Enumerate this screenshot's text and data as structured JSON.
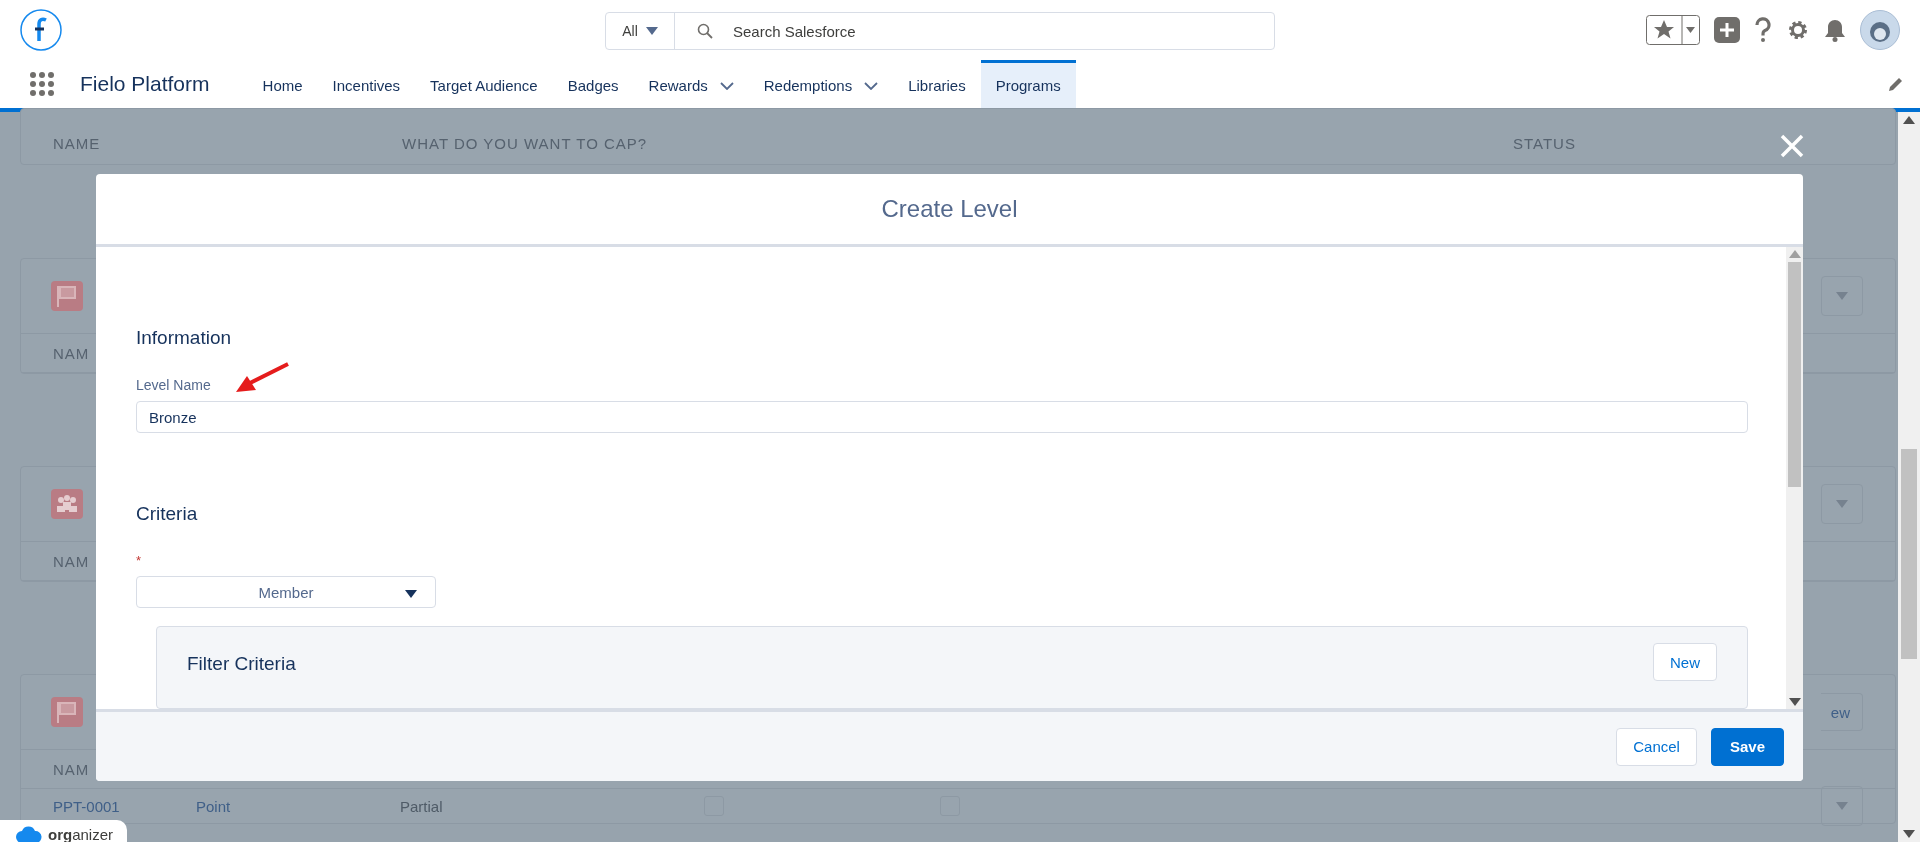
{
  "header": {
    "search_scope": "All",
    "search_placeholder": "Search Salesforce"
  },
  "nav": {
    "app_name": "Fielo Platform",
    "tabs": [
      {
        "label": "Home",
        "selected": false,
        "has_menu": false
      },
      {
        "label": "Incentives",
        "selected": false,
        "has_menu": false
      },
      {
        "label": "Target Audience",
        "selected": false,
        "has_menu": false
      },
      {
        "label": "Badges",
        "selected": false,
        "has_menu": false
      },
      {
        "label": "Rewards",
        "selected": false,
        "has_menu": true
      },
      {
        "label": "Redemptions",
        "selected": false,
        "has_menu": true
      },
      {
        "label": "Libraries",
        "selected": false,
        "has_menu": false
      },
      {
        "label": "Programs",
        "selected": true,
        "has_menu": false
      }
    ]
  },
  "background": {
    "columns": [
      "NAME",
      "WHAT DO YOU WANT TO CAP?",
      "STATUS"
    ],
    "cards": [
      {
        "kind": "flag",
        "row_label": "NAM"
      },
      {
        "kind": "people",
        "row_label": "NAM"
      },
      {
        "kind": "flag",
        "row_label": "NAM",
        "button": "ew",
        "rows": [
          {
            "name": "PPT-0001",
            "type": "Point",
            "mode": "Partial",
            "checks": [
              false,
              false
            ]
          }
        ]
      }
    ]
  },
  "modal": {
    "title": "Create Level",
    "information_heading": "Information",
    "level_name": {
      "label": "Level Name",
      "value": "Bronze"
    },
    "criteria_heading": "Criteria",
    "required_mark": "*",
    "criteria_select": "Member",
    "filter": {
      "title": "Filter Criteria",
      "button": "New"
    },
    "buttons": [
      {
        "label": "Cancel",
        "kind": "neutral"
      },
      {
        "label": "Save",
        "kind": "brand"
      }
    ]
  },
  "organizer": "**org**anizer"
}
